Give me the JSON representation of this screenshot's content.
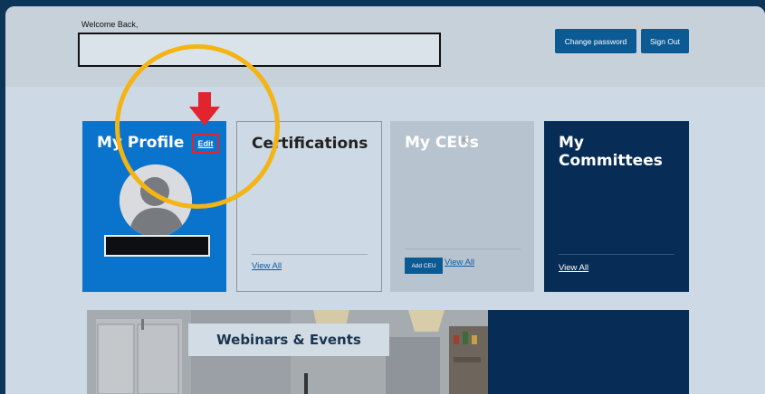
{
  "header": {
    "welcome_text": "Welcome Back,",
    "change_password_label": "Change password",
    "sign_out_label": "Sign Out"
  },
  "cards": {
    "profile": {
      "title": "My Profile",
      "edit_label": "Edit"
    },
    "certifications": {
      "title": "Certifications",
      "view_all_label": "View All"
    },
    "ceus": {
      "title": "My CEUs",
      "add_label": "Add CEU",
      "view_all_label": "View All"
    },
    "committees": {
      "title": "My Committees",
      "view_all_label": "View All"
    }
  },
  "banner": {
    "label": "Webinars & Events"
  },
  "colors": {
    "page_background": "#0d3557",
    "primary_button": "#0b5a94",
    "profile_card": "#0a73cc",
    "committees_card": "#072d57",
    "highlight_circle": "#f3b414",
    "annotation_red": "#e2242f"
  },
  "icons": [
    "avatar-placeholder-icon",
    "down-arrow-icon",
    "cursor-icon"
  ]
}
